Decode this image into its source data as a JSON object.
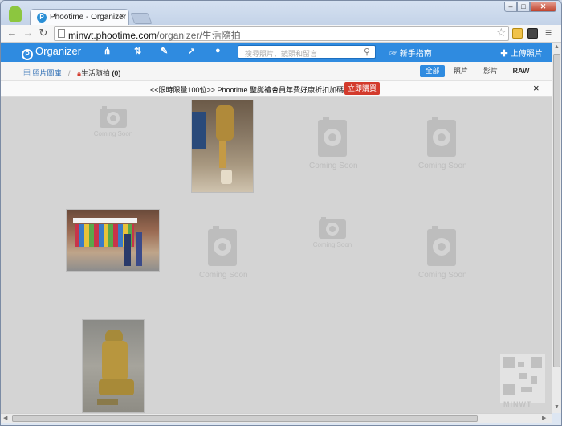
{
  "browser": {
    "tab_title": "Phootime - Organizer",
    "tab_close": "×",
    "url_host": "minwt.phootime.com",
    "url_path": "/organizer/生活隨拍"
  },
  "window_controls": {
    "minimize": "–",
    "maximize": "□",
    "close": "✕"
  },
  "navbar": {
    "brand": "Organizer",
    "brand_logo": "P",
    "search_placeholder": "搜尋照片、鏡頭和留言",
    "guide": "新手指南",
    "upload": "上傳照片",
    "icons": [
      "sitemap-icon",
      "sort-icon",
      "wrench-icon",
      "share-icon",
      "user-icon"
    ]
  },
  "breadcrumb": {
    "root": "照片圖庫",
    "separator": "/",
    "current": "生活隨拍",
    "count": "(0)"
  },
  "filters": [
    "全部",
    "照片",
    "影片",
    "RAW"
  ],
  "promo": {
    "text": "<<限時限量100位>> Phootime 聖誕禮會員年費好康折扣加碼送",
    "button": "立即購買",
    "close": "×"
  },
  "placeholders": {
    "label": "Coming Soon"
  },
  "watermark": "MINWT",
  "colors": {
    "brand_blue": "#2f8be0",
    "promo_red": "#d33a2c"
  }
}
